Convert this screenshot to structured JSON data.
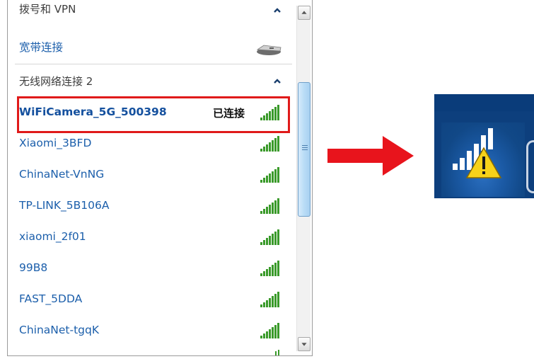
{
  "panel": {
    "dialup_section": {
      "title": "拨号和 VPN",
      "chevron_icon": "chevron-up-icon"
    },
    "broadband": {
      "label": "宽带连接",
      "icon": "broadband-modem-icon"
    },
    "wireless_section": {
      "title": "无线网络连接 2",
      "chevron_icon": "chevron-up-icon"
    },
    "networks": [
      {
        "name": "WiFiCamera_5G_500398",
        "status": "已连接",
        "signal_icon": "wifi-signal-full-icon",
        "selected": true
      },
      {
        "name": "Xiaomi_3BFD",
        "status": "",
        "signal_icon": "wifi-signal-full-icon"
      },
      {
        "name": "ChinaNet-VnNG",
        "status": "",
        "signal_icon": "wifi-signal-full-icon"
      },
      {
        "name": "TP-LINK_5B106A",
        "status": "",
        "signal_icon": "wifi-signal-full-icon"
      },
      {
        "name": "xiaomi_2f01",
        "status": "",
        "signal_icon": "wifi-signal-full-icon"
      },
      {
        "name": "99B8",
        "status": "",
        "signal_icon": "wifi-signal-full-icon"
      },
      {
        "name": "FAST_5DDA",
        "status": "",
        "signal_icon": "wifi-signal-full-icon"
      },
      {
        "name": "ChinaNet-tgqK",
        "status": "",
        "signal_icon": "wifi-signal-full-icon"
      }
    ]
  },
  "annotation": {
    "arrow_icon": "red-right-arrow-icon",
    "highlight_color": "#e01a1a"
  },
  "tray": {
    "icon": "wifi-warning-icon"
  },
  "colors": {
    "link_blue": "#1c5fab",
    "taskbar_blue": "#0d3f7d",
    "warning_yellow": "#f7d21a"
  }
}
